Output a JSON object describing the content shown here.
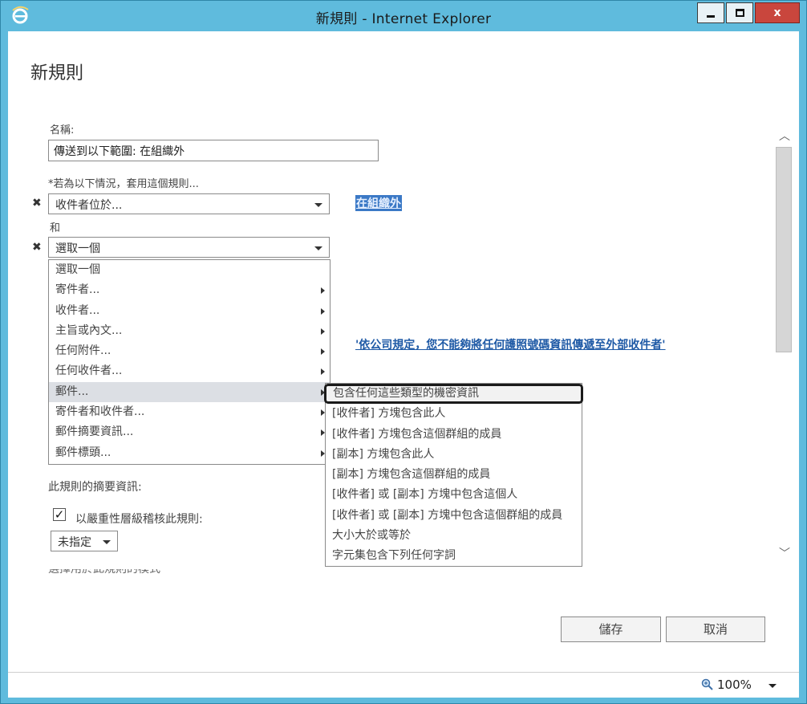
{
  "window": {
    "title": "新規則 - Internet Explorer",
    "controls": {
      "close_label": "x"
    }
  },
  "page": {
    "title": "新規則"
  },
  "name_field": {
    "label": "名稱:",
    "value": "傳送到以下範圍: 在組織外"
  },
  "condition": {
    "label": "*若為以下情況，套用這個規則...",
    "first_select_value": "收件者位於...",
    "first_select_link": "在組織外",
    "and_label": "和",
    "second_select_value": "選取一個",
    "remove_icon": "✖"
  },
  "dropdown_menu": {
    "items": [
      {
        "label": "選取一個",
        "has_submenu": false
      },
      {
        "label": "寄件者...",
        "has_submenu": true
      },
      {
        "label": "收件者...",
        "has_submenu": true
      },
      {
        "label": "主旨或內文...",
        "has_submenu": true
      },
      {
        "label": "任何附件...",
        "has_submenu": true
      },
      {
        "label": "任何收件者...",
        "has_submenu": true
      },
      {
        "label": "郵件...",
        "has_submenu": true,
        "hovered": true
      },
      {
        "label": "寄件者和收件者...",
        "has_submenu": true
      },
      {
        "label": "郵件摘要資訊...",
        "has_submenu": true
      },
      {
        "label": "郵件標頭...",
        "has_submenu": true
      }
    ]
  },
  "submenu": {
    "items": [
      {
        "label": "包含任何這些類型的機密資訊",
        "highlighted": true
      },
      {
        "label": "[收件者] 方塊包含此人"
      },
      {
        "label": "[收件者] 方塊包含這個群組的成員"
      },
      {
        "label": "[副本] 方塊包含此人"
      },
      {
        "label": "[副本] 方塊包含這個群組的成員"
      },
      {
        "label": "[收件者] 或 [副本] 方塊中包含這個人"
      },
      {
        "label": "[收件者] 或 [副本] 方塊中包含這個群組的成員"
      },
      {
        "label": "大小大於或等於"
      },
      {
        "label": "字元集包含下列任何字詞"
      }
    ]
  },
  "action_link": "'依公司規定，您不能夠將任何護照號碼資訊傳遞至外部收件者'",
  "summary": {
    "label": "此規則的摘要資訊:",
    "audit_checkbox_label": "以嚴重性層級稽核此規則:",
    "audit_checked": true,
    "severity_value": "未指定",
    "cut_off_text": "選擇用於此規則的模式"
  },
  "buttons": {
    "save": "儲存",
    "cancel": "取消"
  },
  "status": {
    "zoom": "100%",
    "zoom_icon": "magnifier-icon"
  },
  "colors": {
    "frame": "#5fbbdd",
    "close_button": "#c9463d",
    "link": "#1f5aa6",
    "selected_link_bg": "#3b79c6",
    "menu_hover": "#dcdfe4"
  }
}
